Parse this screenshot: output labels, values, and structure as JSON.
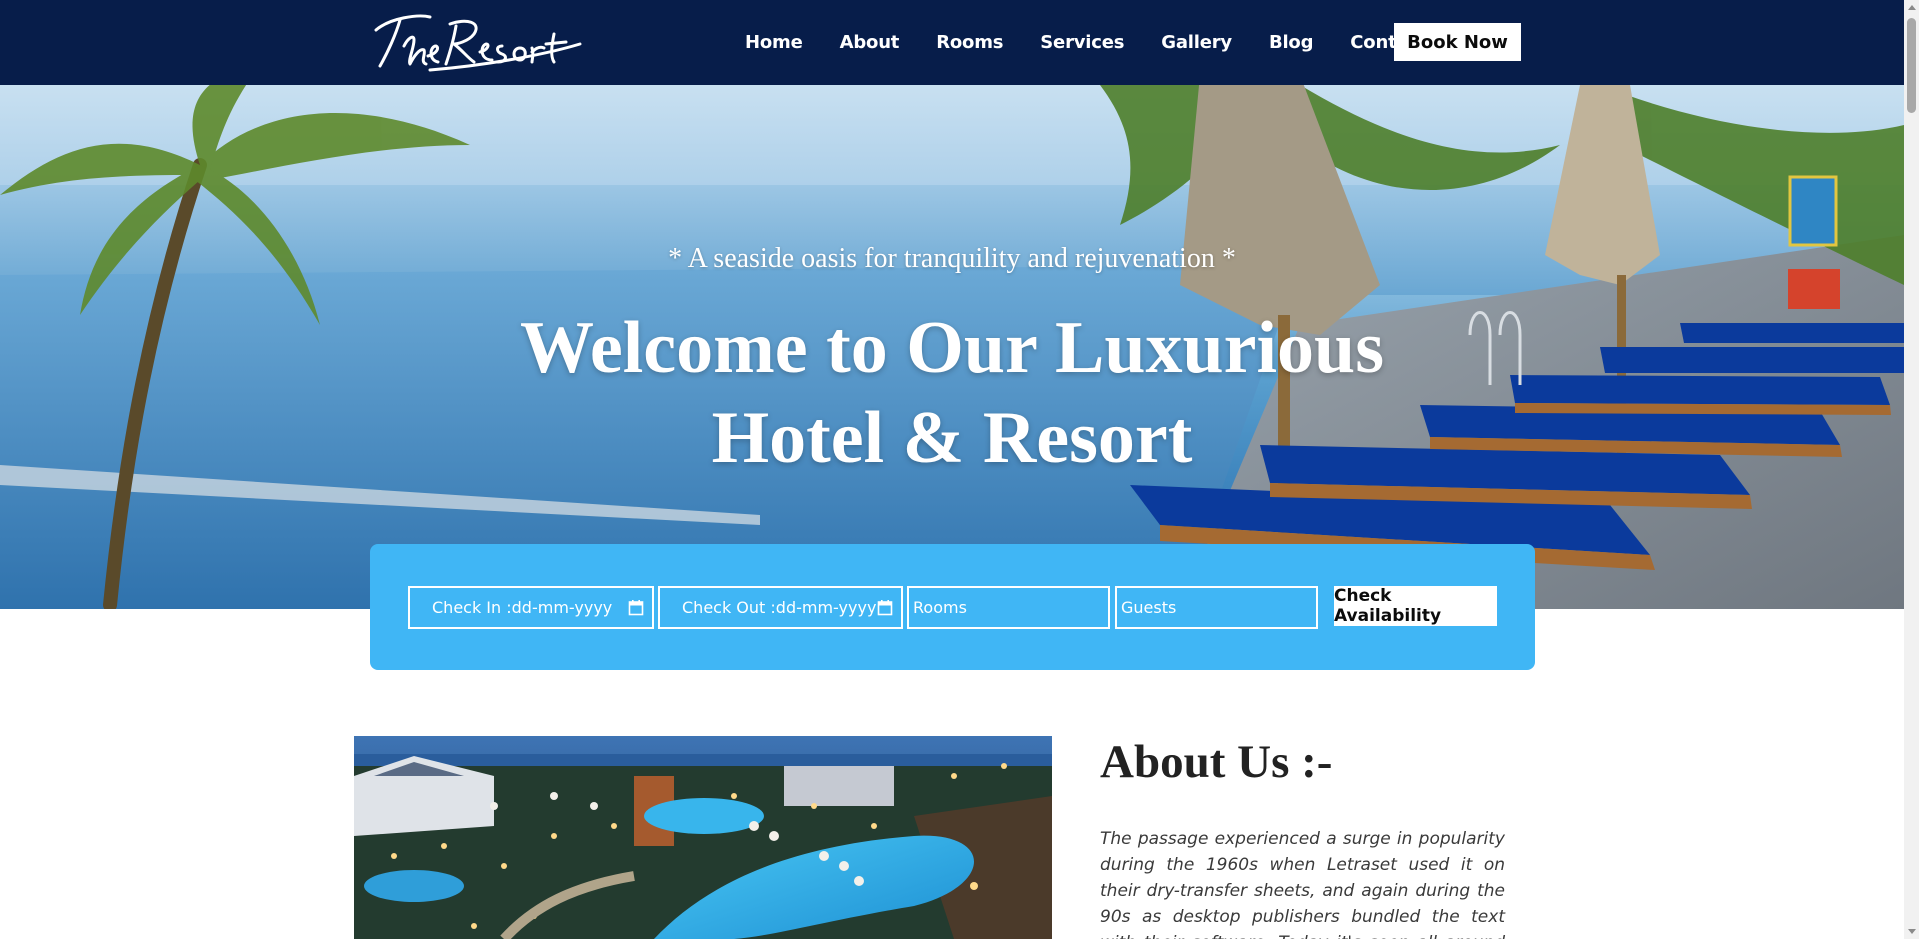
{
  "brand": {
    "logo_text": "The Resort"
  },
  "nav": {
    "items": [
      {
        "label": "Home"
      },
      {
        "label": "About"
      },
      {
        "label": "Rooms"
      },
      {
        "label": "Services"
      },
      {
        "label": "Gallery"
      },
      {
        "label": "Blog"
      },
      {
        "label": "Content"
      }
    ],
    "book_label": "Book Now"
  },
  "hero": {
    "tagline": "* A seaside oasis for tranquility and rejuvenation *",
    "title_line1": "Welcome to Our Luxurious",
    "title_line2": "Hotel & Resort"
  },
  "booking": {
    "check_in_placeholder": "Check In :dd-mm-yyyy",
    "check_out_placeholder": "Check Out :dd-mm-yyyy",
    "rooms_placeholder": "Rooms",
    "guests_placeholder": "Guests",
    "submit_label": "Check Availability"
  },
  "about": {
    "title": "About Us :-",
    "text": "The passage experienced a surge in popularity during the 1960s when Letraset used it on their dry-transfer sheets, and again during the 90s as desktop publishers bundled the text with their software. Today it's seen all around the web."
  },
  "colors": {
    "nav_bg": "#071d4a",
    "booking_bg": "#40b6f5",
    "text_white": "#ffffff"
  },
  "icons": {
    "calendar": "calendar-icon",
    "logo": "resort-logo"
  }
}
